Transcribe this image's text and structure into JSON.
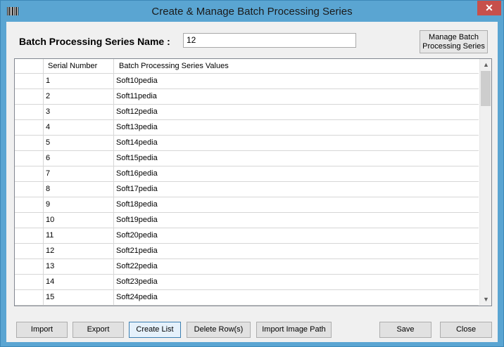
{
  "window": {
    "title": "Create & Manage Batch Processing Series",
    "close_glyph": "✕",
    "icon": "barcode-icon"
  },
  "form": {
    "name_label": "Batch Processing Series Name :",
    "name_value": "12",
    "manage_label": "Manage  Batch\nProcessing Series"
  },
  "grid": {
    "columns": [
      "Serial Number",
      "Batch Processing Series Values"
    ],
    "rows": [
      {
        "serial": "1",
        "value": "Soft10pedia"
      },
      {
        "serial": "2",
        "value": "Soft11pedia"
      },
      {
        "serial": "3",
        "value": "Soft12pedia"
      },
      {
        "serial": "4",
        "value": "Soft13pedia"
      },
      {
        "serial": "5",
        "value": "Soft14pedia"
      },
      {
        "serial": "6",
        "value": "Soft15pedia"
      },
      {
        "serial": "7",
        "value": "Soft16pedia"
      },
      {
        "serial": "8",
        "value": "Soft17pedia"
      },
      {
        "serial": "9",
        "value": "Soft18pedia"
      },
      {
        "serial": "10",
        "value": "Soft19pedia"
      },
      {
        "serial": "11",
        "value": "Soft20pedia"
      },
      {
        "serial": "12",
        "value": "Soft21pedia"
      },
      {
        "serial": "13",
        "value": "Soft22pedia"
      },
      {
        "serial": "14",
        "value": "Soft23pedia"
      },
      {
        "serial": "15",
        "value": "Soft24pedia"
      }
    ]
  },
  "buttons": {
    "import": "Import",
    "export": "Export",
    "create_list": "Create List",
    "delete_rows": "Delete Row(s)",
    "import_image_path": "Import Image Path",
    "save": "Save",
    "close": "Close"
  },
  "colors": {
    "titlebar": "#5aa5d2",
    "close_button": "#c7504b",
    "focused_button": "#e5f1fb"
  }
}
